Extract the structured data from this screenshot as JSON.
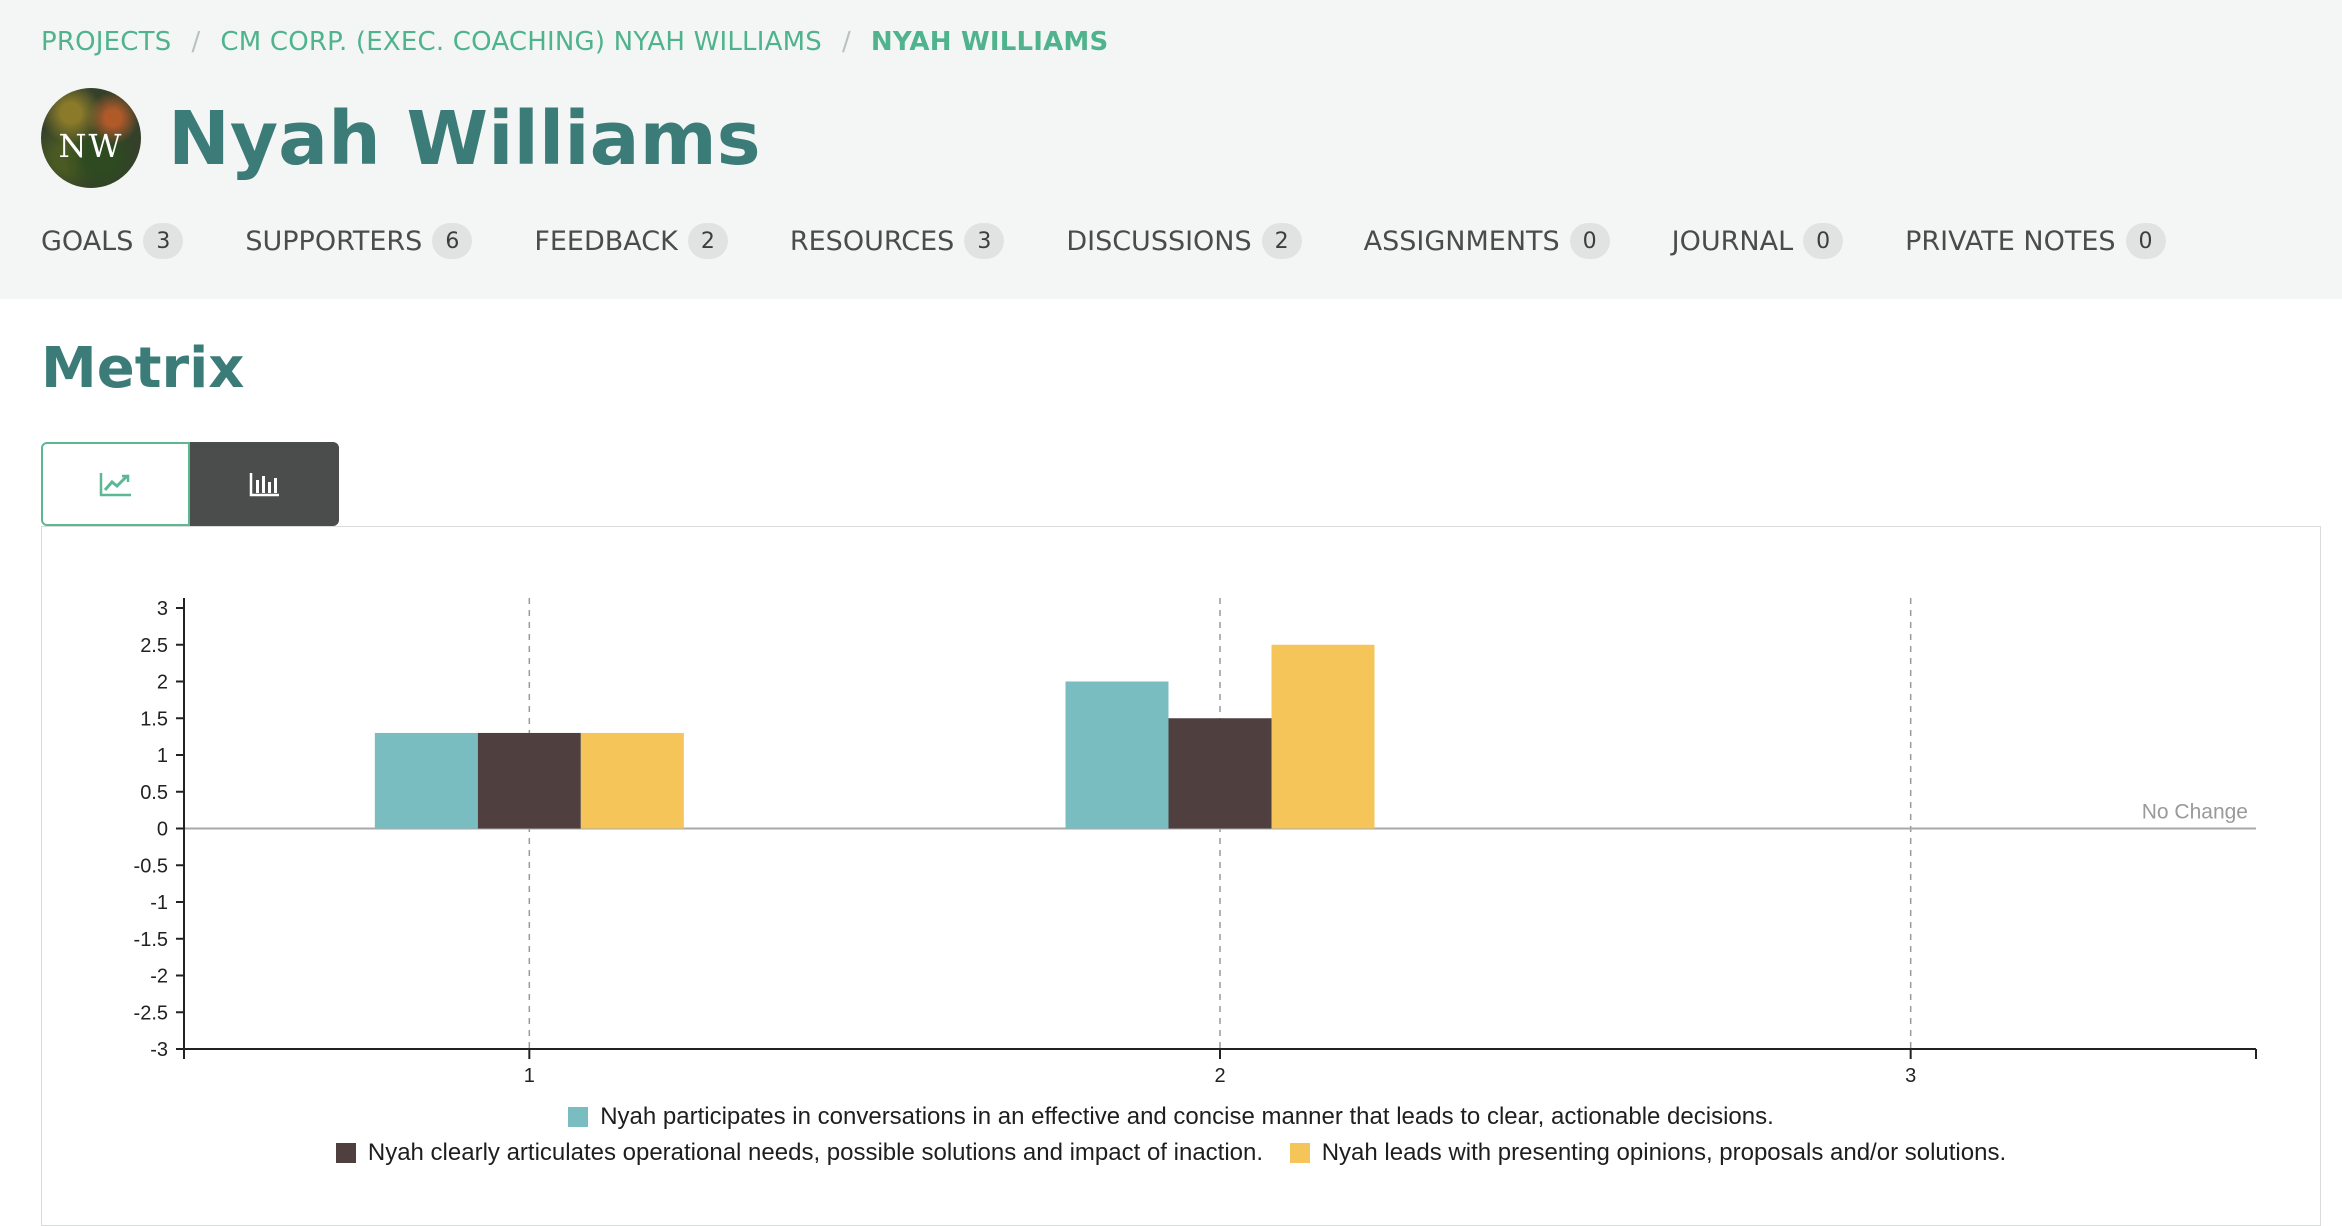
{
  "breadcrumb": {
    "items": [
      "PROJECTS",
      "CM CORP. (EXEC. COACHING) NYAH WILLIAMS"
    ],
    "current": "NYAH WILLIAMS",
    "separator": "/"
  },
  "profile": {
    "initials": "NW",
    "name": "Nyah Williams"
  },
  "tabs": [
    {
      "label": "GOALS",
      "count": "3"
    },
    {
      "label": "SUPPORTERS",
      "count": "6"
    },
    {
      "label": "FEEDBACK",
      "count": "2"
    },
    {
      "label": "RESOURCES",
      "count": "3"
    },
    {
      "label": "DISCUSSIONS",
      "count": "2"
    },
    {
      "label": "ASSIGNMENTS",
      "count": "0"
    },
    {
      "label": "JOURNAL",
      "count": "0"
    },
    {
      "label": "PRIVATE NOTES",
      "count": "0"
    }
  ],
  "section": {
    "title": "Metrix"
  },
  "view_toggle": {
    "active": "bar",
    "options": [
      "line-chart-icon",
      "bar-chart-icon"
    ],
    "active_color": "#4b4d4c",
    "accent_color": "#5cb893"
  },
  "chart_data": {
    "type": "bar",
    "categories": [
      "1",
      "2",
      "3"
    ],
    "ylim": [
      -3,
      3
    ],
    "yticks": [
      "3",
      "2.5",
      "2",
      "1.5",
      "1",
      "0.5",
      "0",
      "-0.5",
      "-1",
      "-1.5",
      "-2",
      "-2.5",
      "-3"
    ],
    "grid": "vertical dashed at categories",
    "annotation": "No Change",
    "series": [
      {
        "name": "Nyah participates in conversations in an effective and concise manner that leads to clear, actionable decisions.",
        "color": "#7abdc1",
        "values": [
          1.3,
          2.0,
          null
        ]
      },
      {
        "name": "Nyah clearly articulates operational needs, possible solutions and impact of inaction.",
        "color": "#4f3f3e",
        "values": [
          1.3,
          1.5,
          null
        ]
      },
      {
        "name": "Nyah leads with presenting opinions, proposals and/or solutions.",
        "color": "#f6c55a",
        "values": [
          1.3,
          2.5,
          null
        ]
      }
    ],
    "legend_placement": "bottom"
  }
}
